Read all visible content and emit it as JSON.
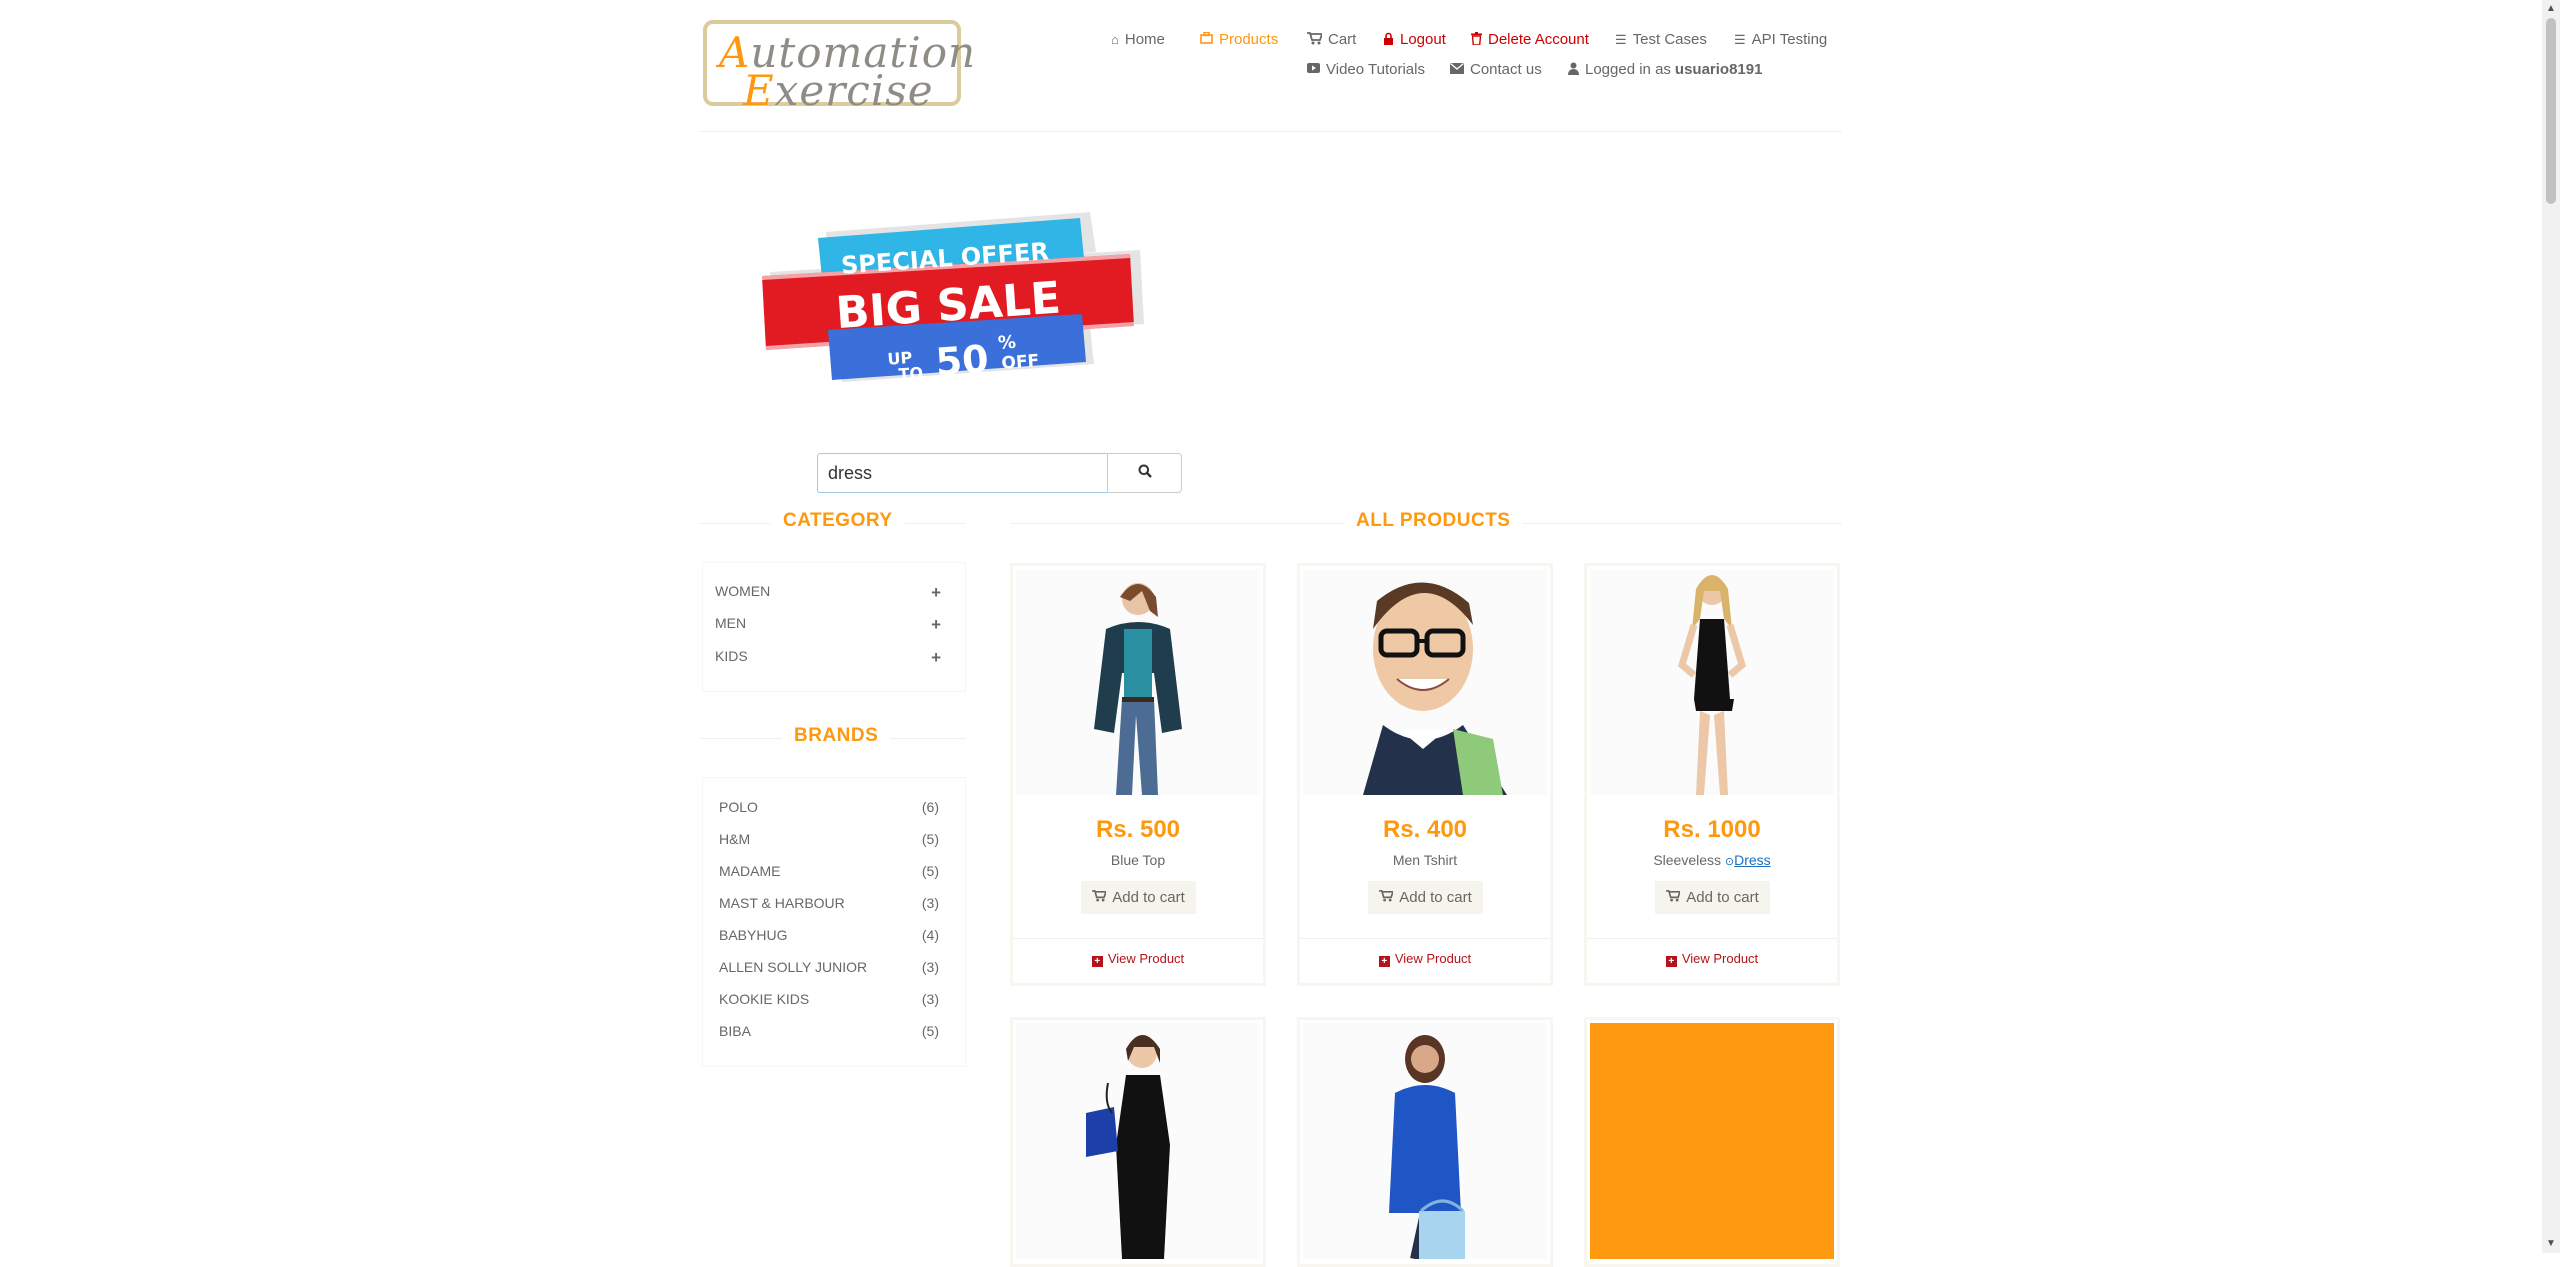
{
  "header": {
    "logo_line1": "Automation",
    "logo_line2": "Exercise",
    "nav": {
      "home": "Home",
      "products": "Products",
      "cart": "Cart",
      "logout": "Logout",
      "delete_account": "Delete Account",
      "test_cases": "Test Cases",
      "api_testing": "API Testing",
      "video_tutorials": "Video Tutorials",
      "contact_us": "Contact us",
      "logged_in_as": "Logged in as",
      "username": "usuario8191"
    }
  },
  "banner": {
    "line1": "SPECIAL OFFER",
    "line2": "BIG SALE",
    "up": "UP",
    "to": "TO",
    "amount": "50",
    "percent": "%",
    "off": "OFF"
  },
  "search": {
    "value": "dress"
  },
  "sidebar": {
    "category_title": "CATEGORY",
    "categories": [
      "WOMEN",
      "MEN",
      "KIDS"
    ],
    "brands_title": "BRANDS",
    "brands": [
      {
        "name": "POLO",
        "count": "(6)"
      },
      {
        "name": "H&M",
        "count": "(5)"
      },
      {
        "name": "MADAME",
        "count": "(5)"
      },
      {
        "name": "MAST & HARBOUR",
        "count": "(3)"
      },
      {
        "name": "BABYHUG",
        "count": "(4)"
      },
      {
        "name": "ALLEN SOLLY JUNIOR",
        "count": "(3)"
      },
      {
        "name": "KOOKIE KIDS",
        "count": "(3)"
      },
      {
        "name": "BIBA",
        "count": "(5)"
      }
    ]
  },
  "main": {
    "title": "ALL PRODUCTS",
    "add_to_cart": "Add to cart",
    "view_product": "View Product",
    "products": [
      {
        "price": "Rs. 500",
        "name": "Blue Top"
      },
      {
        "price": "Rs. 400",
        "name": "Men Tshirt"
      },
      {
        "price": "Rs. 1000",
        "name_prefix": "Sleeveless",
        "name_link": "Dress"
      }
    ]
  },
  "colors": {
    "accent": "#fe980f",
    "danger": "#b4131a",
    "text": "#696763"
  }
}
